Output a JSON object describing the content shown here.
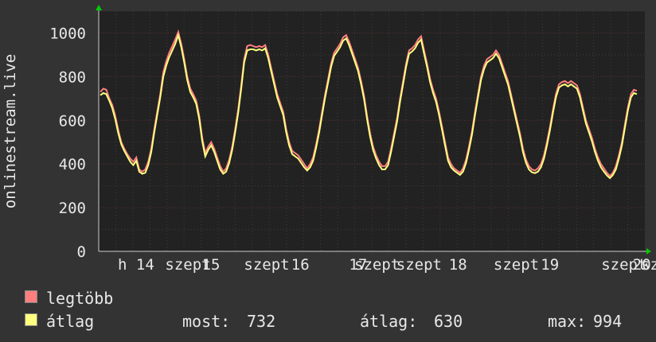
{
  "chart_data": {
    "type": "line",
    "ylabel": "onlinestream.live",
    "ylim": [
      0,
      1100
    ],
    "y_ticks": [
      0,
      200,
      400,
      600,
      800,
      1000
    ],
    "x_tick_labels": [
      "h 14",
      "szept",
      "15",
      "szept",
      "16",
      "szept",
      "17",
      "szept",
      "18",
      "szept",
      "19",
      "szept",
      "20",
      "sz"
    ],
    "grid": true,
    "series": [
      {
        "name": "legtöbb",
        "color": "#ff7f7f",
        "values": [
          730,
          745,
          740,
          700,
          670,
          620,
          555,
          500,
          470,
          445,
          425,
          410,
          430,
          375,
          365,
          375,
          410,
          470,
          560,
          640,
          720,
          820,
          870,
          910,
          940,
          970,
          1005,
          950,
          880,
          800,
          745,
          720,
          690,
          620,
          520,
          450,
          480,
          500,
          470,
          430,
          390,
          365,
          380,
          420,
          480,
          560,
          650,
          760,
          880,
          940,
          945,
          940,
          935,
          940,
          935,
          945,
          900,
          840,
          780,
          720,
          680,
          640,
          560,
          500,
          460,
          450,
          440,
          420,
          400,
          380,
          400,
          430,
          490,
          560,
          640,
          720,
          790,
          860,
          910,
          930,
          950,
          980,
          990,
          960,
          920,
          880,
          840,
          780,
          710,
          620,
          540,
          480,
          440,
          410,
          390,
          390,
          410,
          470,
          540,
          610,
          700,
          780,
          860,
          920,
          930,
          945,
          970,
          985,
          920,
          860,
          790,
          740,
          700,
          640,
          570,
          500,
          430,
          400,
          380,
          370,
          360,
          380,
          420,
          480,
          550,
          640,
          720,
          800,
          850,
          880,
          890,
          900,
          920,
          900,
          860,
          820,
          780,
          720,
          660,
          600,
          540,
          470,
          420,
          390,
          375,
          370,
          380,
          400,
          440,
          500,
          570,
          650,
          720,
          765,
          775,
          780,
          770,
          780,
          770,
          760,
          720,
          660,
          600,
          560,
          520,
          470,
          430,
          400,
          380,
          360,
          345,
          360,
          390,
          440,
          500,
          580,
          660,
          720,
          740,
          735
        ]
      },
      {
        "name": "átlag",
        "color": "#ffff80",
        "values": [
          715,
          725,
          720,
          690,
          655,
          605,
          540,
          490,
          460,
          435,
          410,
          395,
          415,
          365,
          355,
          360,
          395,
          455,
          545,
          625,
          705,
          800,
          850,
          890,
          920,
          950,
          990,
          935,
          865,
          785,
          730,
          705,
          675,
          605,
          505,
          435,
          465,
          485,
          455,
          415,
          375,
          355,
          365,
          405,
          465,
          545,
          635,
          745,
          865,
          920,
          925,
          925,
          920,
          925,
          920,
          930,
          885,
          825,
          765,
          705,
          665,
          625,
          545,
          485,
          445,
          435,
          425,
          405,
          385,
          370,
          385,
          415,
          475,
          545,
          625,
          705,
          775,
          845,
          895,
          915,
          935,
          965,
          975,
          945,
          905,
          865,
          825,
          765,
          695,
          605,
          525,
          465,
          425,
          395,
          375,
          375,
          395,
          455,
          525,
          595,
          685,
          765,
          845,
          905,
          915,
          930,
          955,
          970,
          905,
          845,
          775,
          725,
          685,
          625,
          555,
          485,
          415,
          385,
          370,
          360,
          350,
          365,
          405,
          465,
          535,
          625,
          705,
          785,
          835,
          865,
          875,
          885,
          905,
          885,
          845,
          805,
          765,
          705,
          645,
          585,
          525,
          455,
          405,
          375,
          362,
          358,
          365,
          385,
          425,
          485,
          555,
          635,
          705,
          750,
          760,
          765,
          755,
          765,
          755,
          745,
          705,
          645,
          585,
          545,
          505,
          455,
          415,
          385,
          365,
          348,
          335,
          350,
          375,
          425,
          485,
          565,
          645,
          705,
          725,
          720
        ]
      }
    ]
  },
  "legend": {
    "max_label": "legtöbb",
    "avg_label": "átlag",
    "current_label": "most:",
    "current_value": "732",
    "average_label": "átlag:",
    "average_value": "630",
    "maximum_label": "max:",
    "maximum_value": "994"
  },
  "colors": {
    "background": "#333333",
    "plot_background": "#222222",
    "grid": "#3d3d3d",
    "grid_major": "#5a3030",
    "arrow": "#00cc00"
  }
}
